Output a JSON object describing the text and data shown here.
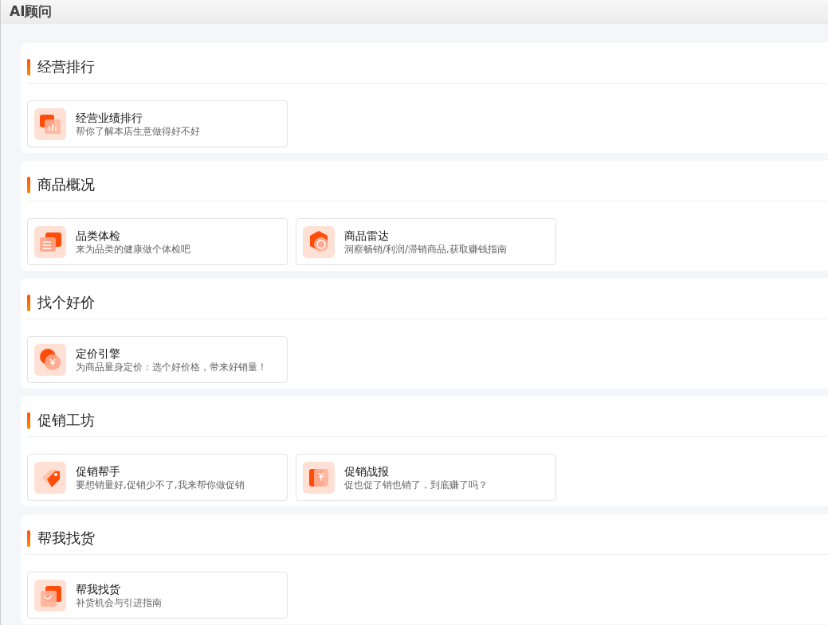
{
  "header": {
    "title": "AI顾问"
  },
  "sections": [
    {
      "title": "经营排行",
      "cards": [
        {
          "kind": "chart",
          "title": "经营业绩排行",
          "description": "帮你了解本店生意做得好不好"
        }
      ]
    },
    {
      "title": "商品概况",
      "cards": [
        {
          "kind": "list",
          "title": "品类体检",
          "description": "来为品类的健康做个体检吧"
        },
        {
          "kind": "radar",
          "title": "商品雷达",
          "description": "洞察畅销/利润/滞销商品,获取赚钱指南"
        }
      ]
    },
    {
      "title": "找个好价",
      "cards": [
        {
          "kind": "coin",
          "title": "定价引擎",
          "description": "为商品量身定价：选个好价格，带来好销量！"
        }
      ]
    },
    {
      "title": "促销工坊",
      "cards": [
        {
          "kind": "tag",
          "title": "促销帮手",
          "description": "要想销量好,促销少不了,我来帮你做促销"
        },
        {
          "kind": "report",
          "title": "促销战报",
          "description": "促也促了销也销了，到底赚了吗？"
        }
      ]
    },
    {
      "title": "帮我找货",
      "cards": [
        {
          "kind": "bag",
          "title": "帮我找货",
          "description": "补货机会与引进指南"
        }
      ]
    }
  ]
}
